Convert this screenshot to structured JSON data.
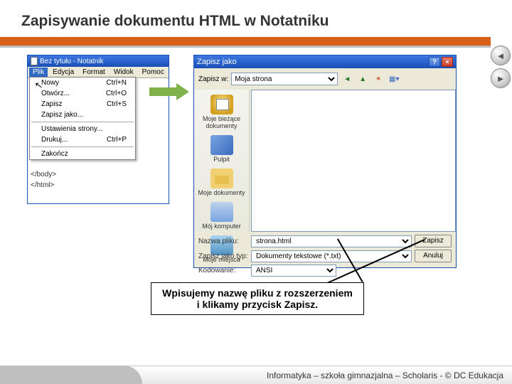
{
  "slide": {
    "title": "Zapisywanie dokumentu HTML w Notatniku"
  },
  "notepad": {
    "window_title": "Bez tytułu - Notatnik",
    "menus": {
      "file": "Plik",
      "edit": "Edycja",
      "format": "Format",
      "view": "Widok",
      "help": "Pomoc"
    },
    "file_menu": {
      "new": {
        "label": "Nowy",
        "accel": "Ctrl+N"
      },
      "open": {
        "label": "Otwórz...",
        "accel": "Ctrl+O"
      },
      "save": {
        "label": "Zapisz",
        "accel": "Ctrl+S"
      },
      "saveas": {
        "label": "Zapisz jako..."
      },
      "page": {
        "label": "Ustawienia strony..."
      },
      "print": {
        "label": "Drukuj...",
        "accel": "Ctrl+P"
      },
      "exit": {
        "label": "Zakończ"
      }
    },
    "body_lines": {
      "l1": "</body>",
      "l2": "</html>"
    }
  },
  "saveas": {
    "title": "Zapisz jako",
    "savein_label": "Zapisz w:",
    "savein_value": "Moja strona",
    "places": {
      "recent": "Moje bieżące dokumenty",
      "desktop": "Pulpit",
      "mydocs": "Moje dokumenty",
      "mycomp": "Mój komputer",
      "network": "Moje miejsca"
    },
    "filename_label": "Nazwa pliku:",
    "filename_value": "strona.html",
    "type_label": "Zapisz jako typ:",
    "type_value": "Dokumenty tekstowe (*.txt)",
    "encoding_label": "Kodowanie:",
    "encoding_value": "ANSI",
    "save_btn": "Zapisz",
    "cancel_btn": "Anuluj",
    "help_glyph": "?",
    "close_glyph": "×"
  },
  "callout": {
    "line1": "Wpisujemy nazwę pliku z rozszerzeniem",
    "line2": "i klikamy przycisk Zapisz."
  },
  "nav": {
    "prev": "◄",
    "next": "►"
  },
  "footer": {
    "text": "Informatyka – szkoła gimnazjalna – Scholaris - © DC Edukacja"
  }
}
